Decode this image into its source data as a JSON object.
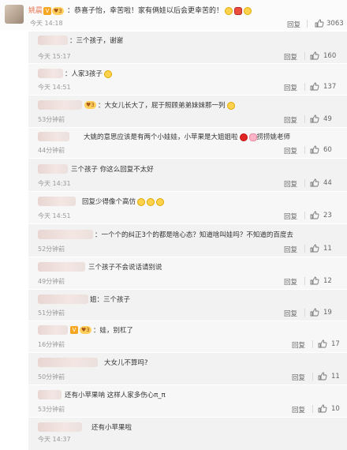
{
  "main_comment": {
    "username": "姚晨",
    "text": "：恭喜子怡，幸苦啦！家有俩娃以后会更幸苦的！",
    "time": "今天 14:18",
    "reply_label": "回复",
    "like_count": "3063"
  },
  "replies": [
    {
      "text": "：三个孩子，谢谢",
      "time": "今天 15:17",
      "reply_label": "回复",
      "like_count": "160"
    },
    {
      "text": "：人家3孩子",
      "time": "今天 14:51",
      "reply_label": "回复",
      "like_count": "137"
    },
    {
      "text": "：大女儿长大了，屁于照顾弟弟妹妹那一列",
      "time": "53分钟前",
      "reply_label": "回复",
      "like_count": "49"
    },
    {
      "text": "大姚的意思应该是有两个小娃娃，小苹果是大姐姐啦",
      "text_tail": "捞捞姚老师",
      "time": "44分钟前",
      "reply_label": "回复",
      "like_count": "60"
    },
    {
      "text": "三个孩子 你这么回复不太好",
      "time": "今天 14:31",
      "reply_label": "回复",
      "like_count": "44"
    },
    {
      "text": "回复少得像个高仿",
      "time": "今天 14:51",
      "reply_label": "回复",
      "like_count": "23"
    },
    {
      "text": "：一个个的纠正3个的都是啥心态？知道啥叫娃吗？不知道的百度去",
      "time": "52分钟前",
      "reply_label": "回复",
      "like_count": "11"
    },
    {
      "text": "三个孩子不会说话请别说",
      "time": "49分钟前",
      "reply_label": "回复",
      "like_count": "12"
    },
    {
      "text": "姐：三个孩子",
      "time": "51分钟前",
      "reply_label": "回复",
      "like_count": "19"
    },
    {
      "text": "：娃，别杠了",
      "time": "16分钟前",
      "reply_label": "回复",
      "like_count": "17"
    },
    {
      "text": "大女儿不算吗?",
      "time": "50分钟前",
      "reply_label": "回复",
      "like_count": "11"
    },
    {
      "text": "还有小苹果呐 这样人家多伤心π_π",
      "time": "53分钟前",
      "reply_label": "回复",
      "like_count": "10"
    },
    {
      "text": "还有小苹果啦",
      "time": "今天 14:37",
      "reply_label": "回复",
      "like_count": ""
    }
  ],
  "icons": {
    "like": "thumbs-up-icon",
    "emoji": "emoji-icon",
    "verified": "verified-badge-icon",
    "fan": "fan-badge-icon"
  },
  "colors": {
    "username": "#eb7350",
    "meta": "#999999",
    "reply_bg": "#f2f2f2"
  }
}
